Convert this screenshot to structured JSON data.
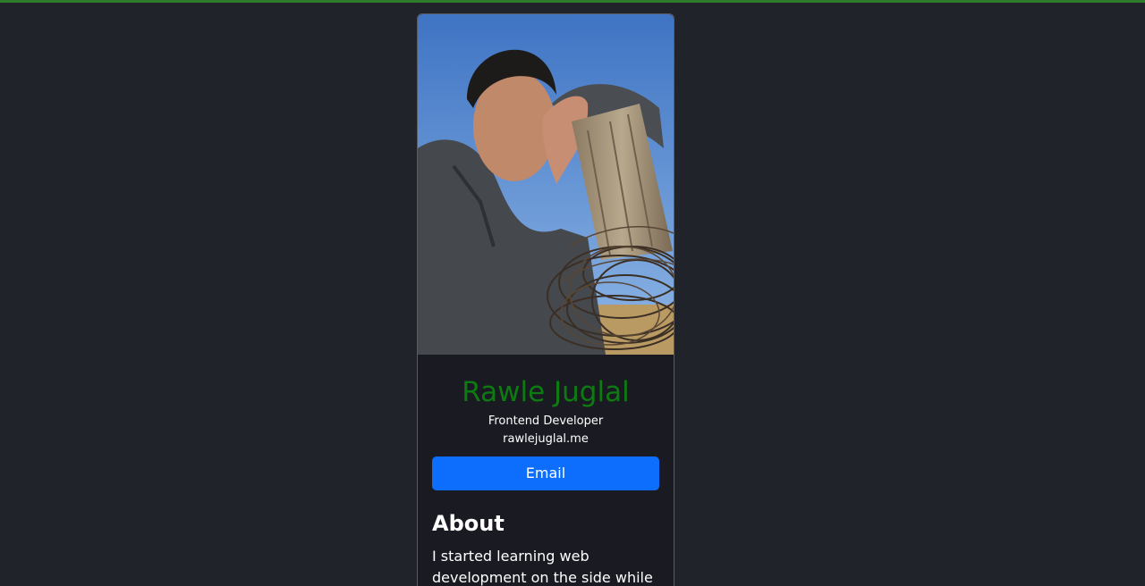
{
  "profile": {
    "photo_alt": "profile-photo",
    "name": "Rawle Juglal",
    "title": "Frontend Developer",
    "website": "rawlejuglal.me",
    "email_label": "Email"
  },
  "about": {
    "heading": "About",
    "text": "I started learning web development on the side while I worked in video"
  },
  "colors": {
    "page_background": "#21232b",
    "card_background": "#1a1b22",
    "name_green": "#0e7a12",
    "button_blue": "#0d6efd",
    "top_bar_green": "#2f7d2a"
  }
}
